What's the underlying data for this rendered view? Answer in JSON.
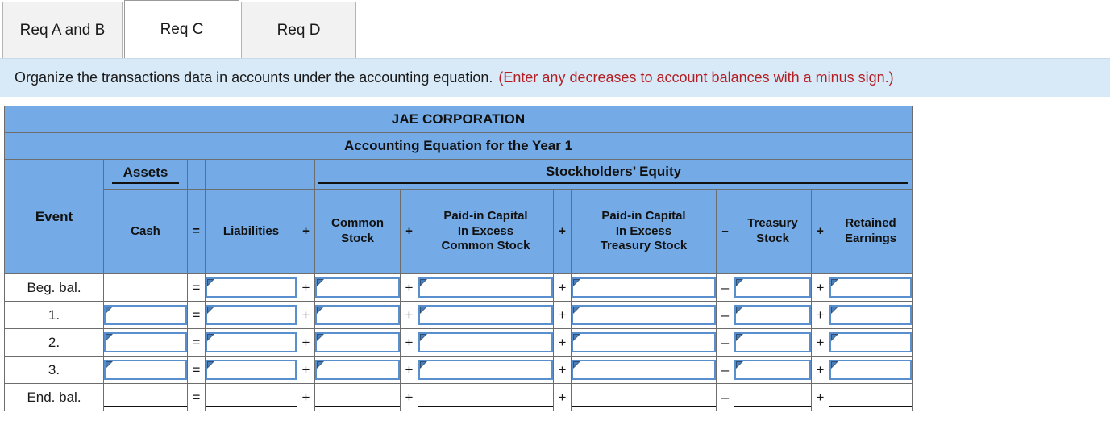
{
  "tabs": [
    {
      "label": "Req A and B",
      "active": false
    },
    {
      "label": "Req C",
      "active": true
    },
    {
      "label": "Req D",
      "active": false
    }
  ],
  "instruction": {
    "text": "Organize the transactions data in accounts under the accounting equation.",
    "note": "(Enter any decreases to account balances with a minus sign.)",
    "note_color": "#b41f24",
    "background": "#d8eaf8"
  },
  "table": {
    "header_color": "#74abe6",
    "company": "JAE CORPORATION",
    "subtitle": "Accounting Equation for the Year 1",
    "groups": {
      "assets": "Assets",
      "stockholders_equity": "Stockholders’ Equity"
    },
    "columns": {
      "event": "Event",
      "cash": "Cash",
      "eq": "=",
      "liabilities": "Liabilities",
      "plus1": "+",
      "common_stock": "Common Stock",
      "plus2": "+",
      "picecs": "Paid-in Capital In Excess Common Stock",
      "plus3": "+",
      "picets": "Paid-in Capital In Excess Treasury Stock",
      "minus": "–",
      "treasury_stock": "Treasury Stock",
      "plus4": "+",
      "retained_earnings": "Retained Earnings"
    },
    "column_lines": {
      "common_stock_1": "Common",
      "common_stock_2": "Stock",
      "picecs_1": "Paid-in Capital",
      "picecs_2": "In Excess",
      "picecs_3": "Common Stock",
      "picets_1": "Paid-in Capital",
      "picets_2": "In Excess",
      "picets_3": "Treasury Stock",
      "treasury_1": "Treasury",
      "treasury_2": "Stock",
      "retained_1": "Retained",
      "retained_2": "Earnings"
    },
    "rows": [
      {
        "event": "Beg. bal.",
        "cash_input": false,
        "inputs": true,
        "total": false
      },
      {
        "event": "1.",
        "cash_input": true,
        "inputs": true,
        "total": false
      },
      {
        "event": "2.",
        "cash_input": true,
        "inputs": true,
        "total": false
      },
      {
        "event": "3.",
        "cash_input": true,
        "inputs": true,
        "total": false
      },
      {
        "event": "End. bal.",
        "cash_input": false,
        "inputs": false,
        "total": true
      }
    ],
    "operators": {
      "eq": "=",
      "plus": "+",
      "minus": "–"
    }
  }
}
